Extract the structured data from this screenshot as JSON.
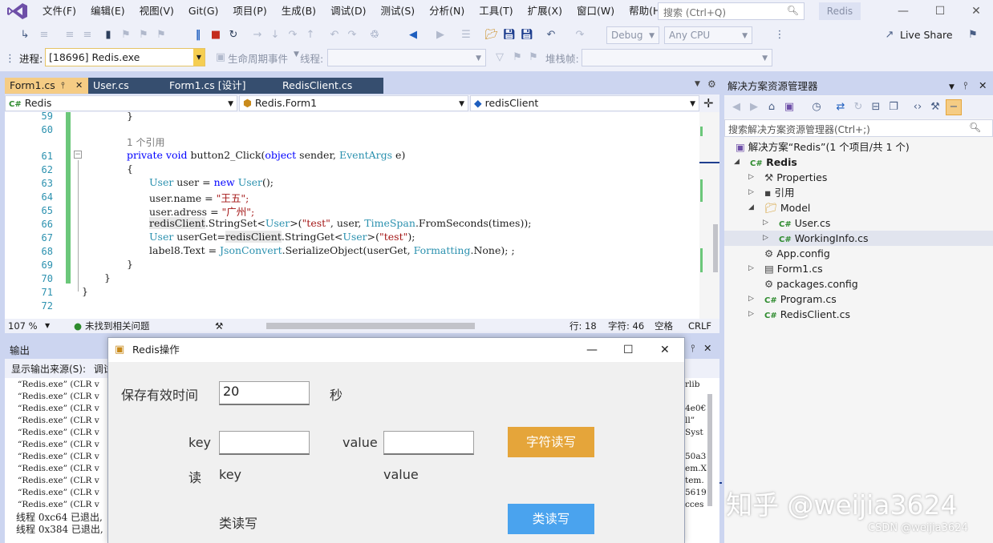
{
  "menu": [
    "文件(F)",
    "编辑(E)",
    "视图(V)",
    "Git(G)",
    "项目(P)",
    "生成(B)",
    "调试(D)",
    "测试(S)",
    "分析(N)",
    "工具(T)",
    "扩展(X)",
    "窗口(W)",
    "帮助(H)"
  ],
  "search": {
    "placeholder": "搜索 (Ctrl+Q)"
  },
  "app_name": "Redis",
  "toolbar": {
    "config": "Debug",
    "platform": "Any CPU",
    "live_share": "Live Share"
  },
  "debug_bar": {
    "process_label": "进程:",
    "process_value": "[18696] Redis.exe",
    "lifecycle_label": "生命周期事件",
    "thread_label": "线程:",
    "stack_label": "堆栈帧:"
  },
  "tabs": [
    {
      "label": "Form1.cs"
    },
    {
      "label": "User.cs"
    },
    {
      "label": "Form1.cs [设计]"
    },
    {
      "label": "RedisClient.cs"
    }
  ],
  "nav": {
    "project": "Redis",
    "class": "Redis.Form1",
    "member": "redisClient"
  },
  "code": {
    "line_numbers": [
      "59",
      "60",
      "61",
      "62",
      "63",
      "64",
      "65",
      "66",
      "67",
      "68",
      "69",
      "70",
      "71",
      "72"
    ],
    "ref_count": "1 个引用",
    "lines": {
      "l59": "}",
      "l61": "private void button2_Click(object sender, EventArgs e)",
      "l62": "{",
      "l63": "User user = new User();",
      "l64_a": "user.name = ",
      "l64_b": "\"王五\";",
      "l65_a": "user.adress = ",
      "l65_b": "\"广州\";",
      "l66": "redisClient.StringSet<User>(\"test\", user, TimeSpan.FromSeconds(times));",
      "l67": "User userGet=redisClient.StringGet<User>(\"test\");",
      "l68": "label8.Text = JsonConvert.SerializeObject(userGet, Formatting.None); ;",
      "l69": "}",
      "l70": "}",
      "l71": "}"
    }
  },
  "editor_status": {
    "zoom": "107 %",
    "issues": "未找到相关问题",
    "row": "行: 18",
    "col": "字符: 46",
    "space": "空格",
    "eol": "CRLF"
  },
  "solution": {
    "title": "解决方案资源管理器",
    "search_placeholder": "搜索解决方案资源管理器(Ctrl+;)",
    "root": "解决方案“Redis”(1 个项目/共 1 个)",
    "items": [
      {
        "label": "Redis"
      },
      {
        "label": "Properties"
      },
      {
        "label": "引用"
      },
      {
        "label": "Model"
      },
      {
        "label": "User.cs"
      },
      {
        "label": "WorkingInfo.cs"
      },
      {
        "label": "App.config"
      },
      {
        "label": "Form1.cs"
      },
      {
        "label": "packages.config"
      },
      {
        "label": "Program.cs"
      },
      {
        "label": "RedisClient.cs"
      }
    ]
  },
  "output": {
    "title": "输出",
    "source_label": "显示输出来源(S):",
    "source_value": "调试",
    "lines": [
      "“Redis.exe” (CLR v",
      "“Redis.exe” (CLR v",
      "“Redis.exe” (CLR v",
      "“Redis.exe” (CLR v",
      "“Redis.exe” (CLR v",
      "“Redis.exe” (CLR v",
      "“Redis.exe” (CLR v",
      "“Redis.exe” (CLR v",
      "“Redis.exe” (CLR v",
      "“Redis.exe” (CLR v",
      "“Redis.exe” (CLR v"
    ],
    "thread_lines": [
      "线程 0xc64 已退出,",
      "线程 0x384 已退出,"
    ],
    "right_frag": [
      "rlib",
      "",
      "4e0€",
      "ll”",
      "Syst",
      "",
      "50a3",
      "em.X",
      "tem.",
      "5619",
      "cces"
    ]
  },
  "dialog": {
    "title": "Redis操作",
    "expire_label": "保存有效时间",
    "expire_value": "20",
    "seconds_unit": "秒",
    "key_label": "key",
    "value_label": "value",
    "string_button": "字符读写",
    "read_label": "读",
    "read_key": "key",
    "read_value": "value",
    "class_label": "类读写",
    "class_button": "类读写",
    "colors": {
      "string_button": "#e5a53a",
      "class_button": "#4aa3ee"
    }
  },
  "watermark": "知乎 @weijia3624",
  "csdn_mark": "CSDN @weijia3624"
}
